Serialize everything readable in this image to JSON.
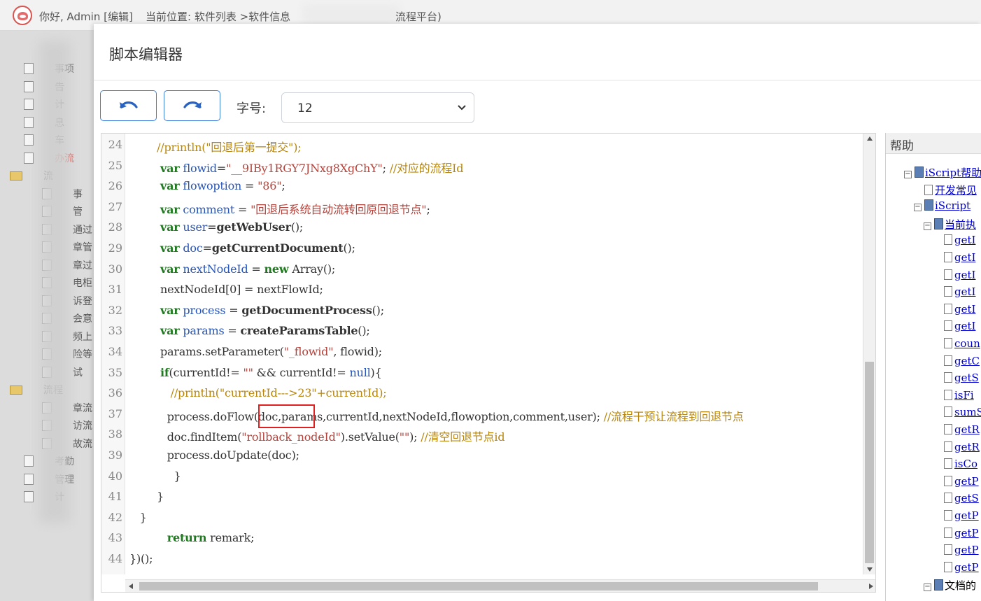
{
  "header": {
    "greeting": "你好, Admin [编辑]",
    "breadcrumb": "当前位置: 软件列表 >软件信息",
    "breadcrumb_tail": "流程平台)"
  },
  "bg_tree": {
    "items": [
      {
        "label": "事项",
        "kind": "doc"
      },
      {
        "label": "告",
        "kind": "doc"
      },
      {
        "label": "计",
        "kind": "doc"
      },
      {
        "label": "息",
        "kind": "doc"
      },
      {
        "label": "车",
        "kind": "doc"
      },
      {
        "label": "办流",
        "kind": "doc",
        "highlight": true
      },
      {
        "label": "流",
        "kind": "folder"
      },
      {
        "label": "事",
        "kind": "doc"
      },
      {
        "label": "管",
        "kind": "doc"
      },
      {
        "label": "通过",
        "kind": "doc"
      },
      {
        "label": "章管",
        "kind": "doc"
      },
      {
        "label": "章过",
        "kind": "doc"
      },
      {
        "label": "电柜",
        "kind": "doc"
      },
      {
        "label": "诉登",
        "kind": "doc"
      },
      {
        "label": "会意",
        "kind": "doc"
      },
      {
        "label": "频上",
        "kind": "doc"
      },
      {
        "label": "险等",
        "kind": "doc"
      },
      {
        "label": "试",
        "kind": "doc"
      },
      {
        "label": "流程",
        "kind": "folder"
      },
      {
        "label": "章流",
        "kind": "doc"
      },
      {
        "label": "访流",
        "kind": "doc"
      },
      {
        "label": "故流",
        "kind": "doc"
      },
      {
        "label": "考勤",
        "kind": "doc"
      },
      {
        "label": "管理",
        "kind": "doc"
      },
      {
        "label": "计",
        "kind": "doc"
      }
    ]
  },
  "modal": {
    "title": "脚本编辑器",
    "font_size_label": "字号:",
    "font_size_value": "12"
  },
  "editor": {
    "lines": [
      {
        "n": "24",
        "html": "<span class=\"cm\">        //println(\"回退后第一提交\");</span>"
      },
      {
        "n": "25",
        "html": "         <span class=\"kw\">var</span> <span class=\"vn\">flowid</span>=<span class=\"st\">\"__9IBy1RGY7JNxg8XgChY\"</span>; <span class=\"cm\">//对应的流程Id</span>"
      },
      {
        "n": "26",
        "html": "         <span class=\"kw\">var</span> <span class=\"vn\">flowoption</span> = <span class=\"st\">\"86\"</span>;"
      },
      {
        "n": "27",
        "html": "         <span class=\"kw\">var</span> <span class=\"vn\">comment</span> = <span class=\"st\">\"回退后系统自动流转回原回退节点\"</span>;"
      },
      {
        "n": "28",
        "html": "         <span class=\"kw\">var</span> <span class=\"vn\">user</span>=<span class=\"fn\">getWebUser</span>();"
      },
      {
        "n": "29",
        "html": "         <span class=\"kw\">var</span> <span class=\"vn\">doc</span>=<span class=\"fn\">getCurrentDocument</span>();"
      },
      {
        "n": "30",
        "html": "         <span class=\"kw\">var</span> <span class=\"vn\">nextNodeId</span> = <span class=\"kw\">new</span> Array();"
      },
      {
        "n": "31",
        "html": "         nextNodeId[0] = nextFlowId;"
      },
      {
        "n": "32",
        "html": "         <span class=\"kw\">var</span> <span class=\"vn\">process</span> = <span class=\"fn\">getDocumentProcess</span>();"
      },
      {
        "n": "33",
        "html": "         <span class=\"kw\">var</span> <span class=\"vn\">params</span> = <span class=\"fn\">createParamsTable</span>();"
      },
      {
        "n": "34",
        "html": "         params.setParameter(<span class=\"st\">\"_flowid\"</span>, flowid);"
      },
      {
        "n": "35",
        "html": "         <span class=\"kw\">if</span>(currentId!= <span class=\"st\">\"\"</span> &amp;&amp; currentId!= <span class=\"vn\">null</span>){"
      },
      {
        "n": "36",
        "html": "            <span class=\"cm\">//println(\"currentId---&gt;23\"+currentId);</span>"
      },
      {
        "n": "37",
        "html": "           process.doFlow(doc,params,currentId,nextNodeId,flowoption,comment,user); <span class=\"cm\">//流程干预让流程到回退节点</span>"
      },
      {
        "n": "38",
        "html": "           doc.findItem(<span class=\"st\">\"rollback_nodeId\"</span>).setValue(<span class=\"st\">\"\"</span>); <span class=\"cm\">//清空回退节点id</span>"
      },
      {
        "n": "39",
        "html": "           process.doUpdate(doc);"
      },
      {
        "n": "40",
        "html": "             }"
      },
      {
        "n": "41",
        "html": "        }"
      },
      {
        "n": "42",
        "html": "   }"
      },
      {
        "n": "43",
        "html": "           <span class=\"kw\">return</span> remark;"
      },
      {
        "n": "44",
        "html": "})();"
      }
    ]
  },
  "help": {
    "title": "帮助",
    "nodes": [
      {
        "indent": 0,
        "exp": "−",
        "icon": "book",
        "label": "iScript帮助",
        "link": true
      },
      {
        "indent": 1,
        "exp": "",
        "icon": "doc",
        "label": "开发常见",
        "link": true
      },
      {
        "indent": 1,
        "exp": "−",
        "icon": "book",
        "label": "iScript",
        "link": true
      },
      {
        "indent": 2,
        "exp": "−",
        "icon": "book",
        "label": "当前执",
        "link": true
      },
      {
        "indent": 3,
        "exp": "",
        "icon": "doc",
        "label": "getI",
        "link": true
      },
      {
        "indent": 3,
        "exp": "",
        "icon": "doc",
        "label": "getI",
        "link": true
      },
      {
        "indent": 3,
        "exp": "",
        "icon": "doc",
        "label": "getI",
        "link": true
      },
      {
        "indent": 3,
        "exp": "",
        "icon": "doc",
        "label": "getI",
        "link": true
      },
      {
        "indent": 3,
        "exp": "",
        "icon": "doc",
        "label": "getI",
        "link": true
      },
      {
        "indent": 3,
        "exp": "",
        "icon": "doc",
        "label": "getI",
        "link": true
      },
      {
        "indent": 3,
        "exp": "",
        "icon": "doc",
        "label": "coun",
        "link": true
      },
      {
        "indent": 3,
        "exp": "",
        "icon": "doc",
        "label": "getC",
        "link": true
      },
      {
        "indent": 3,
        "exp": "",
        "icon": "doc",
        "label": "getS",
        "link": true
      },
      {
        "indent": 3,
        "exp": "",
        "icon": "doc",
        "label": "isFi",
        "link": true
      },
      {
        "indent": 3,
        "exp": "",
        "icon": "doc",
        "label": "sumS",
        "link": true
      },
      {
        "indent": 3,
        "exp": "",
        "icon": "doc",
        "label": "getR",
        "link": true
      },
      {
        "indent": 3,
        "exp": "",
        "icon": "doc",
        "label": "getR",
        "link": true
      },
      {
        "indent": 3,
        "exp": "",
        "icon": "doc",
        "label": "isCo",
        "link": true
      },
      {
        "indent": 3,
        "exp": "",
        "icon": "doc",
        "label": "getP",
        "link": true
      },
      {
        "indent": 3,
        "exp": "",
        "icon": "doc",
        "label": "getS",
        "link": true
      },
      {
        "indent": 3,
        "exp": "",
        "icon": "doc",
        "label": "getP",
        "link": true
      },
      {
        "indent": 3,
        "exp": "",
        "icon": "doc",
        "label": "getP",
        "link": true
      },
      {
        "indent": 3,
        "exp": "",
        "icon": "doc",
        "label": "getP",
        "link": true
      },
      {
        "indent": 3,
        "exp": "",
        "icon": "doc",
        "label": "getP",
        "link": true
      },
      {
        "indent": 2,
        "exp": "−",
        "icon": "book",
        "label": "文档的",
        "link": false
      }
    ]
  },
  "colors": {
    "accent": "#3b7ddd",
    "keyword": "#1f7a1f",
    "variable": "#2855b8",
    "string": "#b5423a",
    "comment": "#b8860b",
    "highlight_box": "#e02020"
  }
}
